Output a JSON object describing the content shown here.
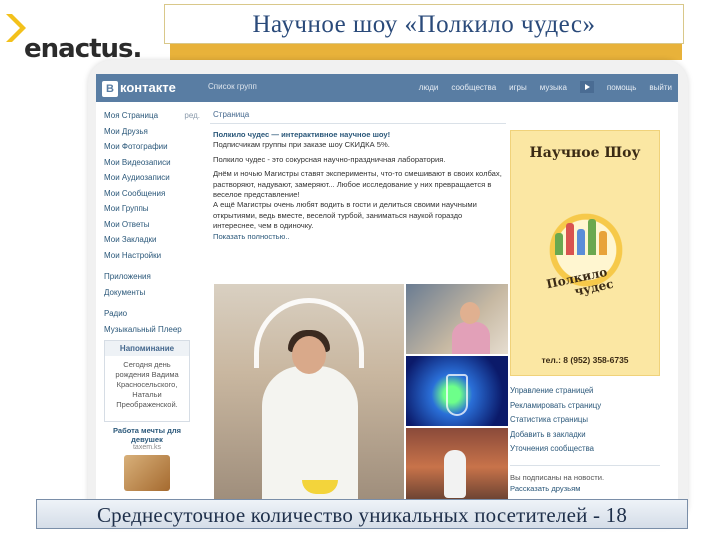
{
  "slide": {
    "title": "Научное шоу «Полкило чудес»",
    "caption": "Среднесуточное количество уникальных посетителей - 18",
    "logo_text": "enactus.",
    "accent_color": "#e8b23a",
    "title_color": "#2a4a7a"
  },
  "vk": {
    "logo": "контакте",
    "logo_letter": "В",
    "search": "Список групп",
    "nav": [
      "люди",
      "сообщества",
      "игры",
      "музыка",
      "помощь",
      "выйти"
    ],
    "header_color": "#597da3",
    "left_menu": [
      "Моя Страница",
      "Мои Друзья",
      "Мои Фотографии",
      "Мои Видеозаписи",
      "Мои Аудиозаписи",
      "Мои Сообщения",
      "Мои Группы",
      "Мои Ответы",
      "Мои Закладки",
      "Мои Настройки"
    ],
    "left_edit": "ред.",
    "left_menu_2": [
      "Приложения",
      "Документы"
    ],
    "left_menu_3": [
      "Радио",
      "Музыкальный Плеер"
    ],
    "reminder": {
      "title": "Напоминание",
      "body": "Сегодня день рождения Вадима Красносельского, Натальи Преображенской."
    },
    "ad": {
      "title": "Работа мечты для девушек",
      "url": "taxem.ks"
    },
    "page_tab": "Страница",
    "post": {
      "headline": "Полкило чудес — интерактивное научное шоу!",
      "discount": "Подписчикам группы при заказе шоу СКИДКА 5%.",
      "intro": "Полкило чудес - это сокурсная научно-праздничная лаборатория.",
      "body": "Днём и ночью Магистры ставят эксперименты, что-то смешивают в своих колбах, растворяют, надувают, замеряют... Любое исследование у них превращается в веселое представление!",
      "body2": "А ещё Магистры очень любят водить в гости и делиться своими научными открытиями, ведь вместе, веселой турбой, заниматься наукой гораздо интереснее, чем в одиночку.",
      "more": "Показать полностью.."
    },
    "poster": {
      "title": "Научное Шоу",
      "name_line1": "Полкило",
      "name_line2": "чудес",
      "tel": "тел.: 8 (952) 358-6735"
    },
    "actions": [
      "Управление страницей",
      "Рекламировать страницу",
      "Статистика страницы",
      "Добавить в закладки",
      "Уточнения сообщества"
    ],
    "subscribed": "Вы подписаны на новости.",
    "tell_friends": "Рассказать друзьям"
  }
}
